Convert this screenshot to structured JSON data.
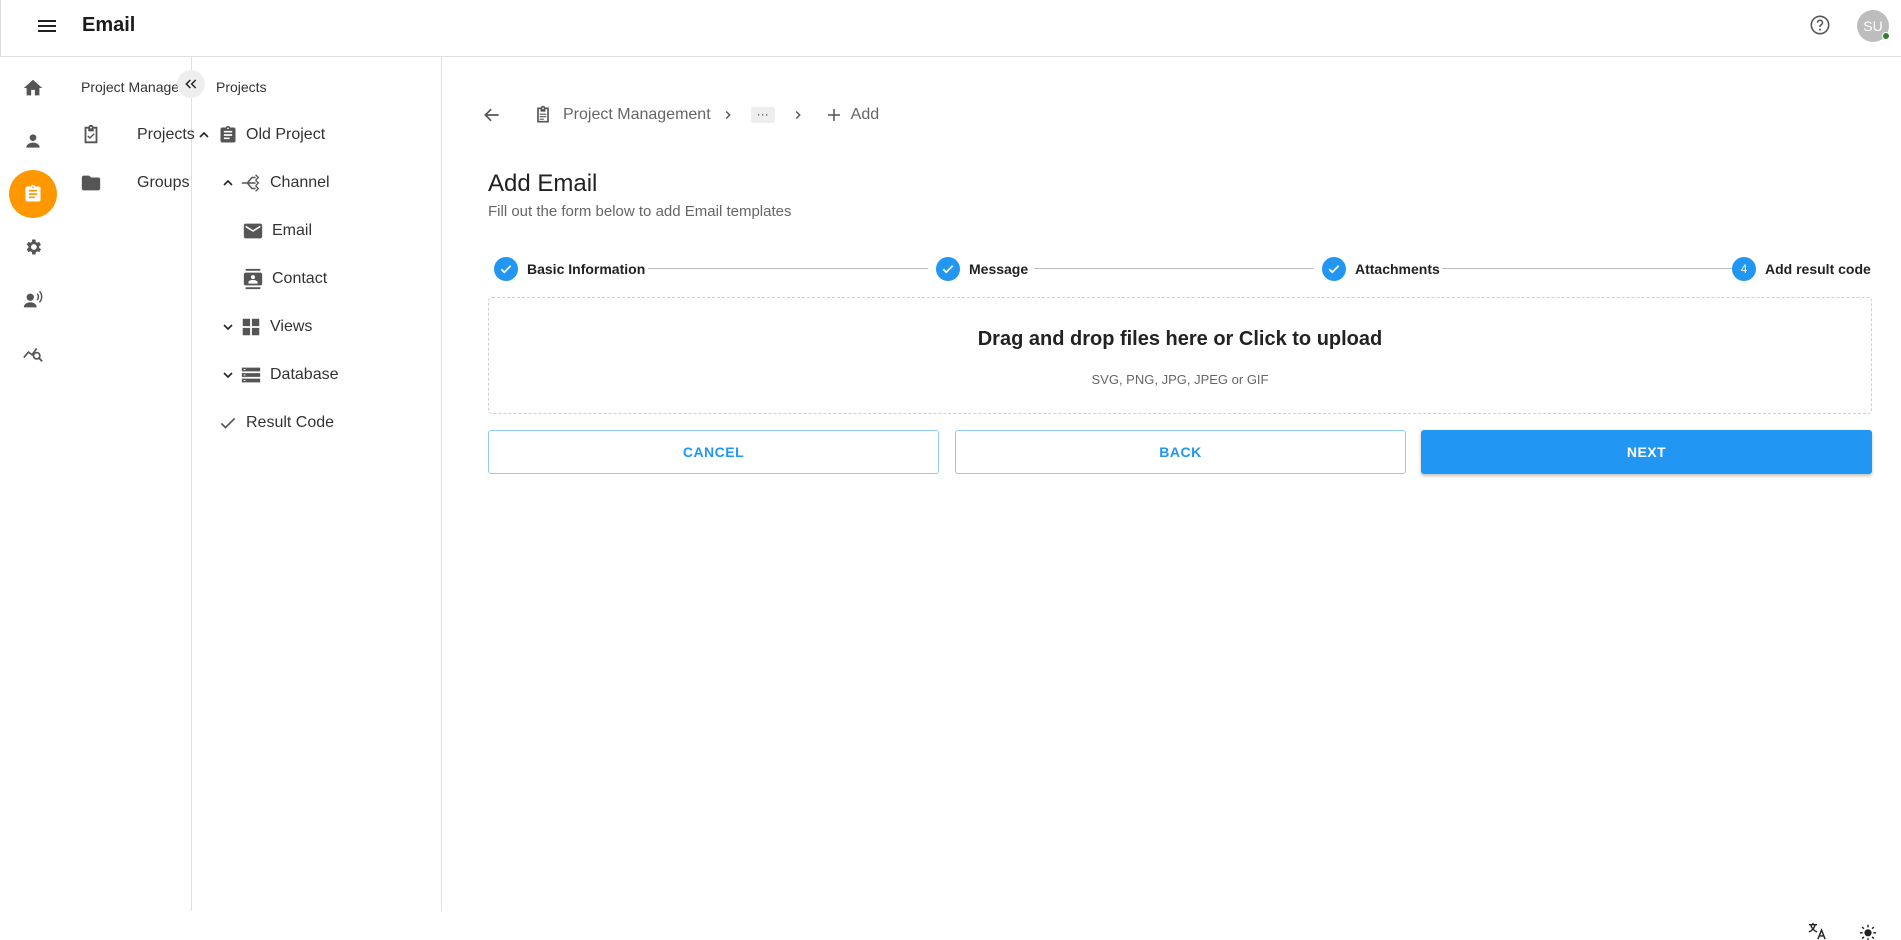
{
  "header": {
    "title": "Email",
    "avatar_initials": "SU"
  },
  "rail": {
    "items": [
      {
        "icon": "home-icon"
      },
      {
        "icon": "person-icon"
      },
      {
        "icon": "clipboard-icon",
        "active": true
      },
      {
        "icon": "settings-icon"
      },
      {
        "icon": "record-voice-icon"
      },
      {
        "icon": "analytics-search-icon"
      }
    ]
  },
  "panel1": {
    "title": "Project Management",
    "items": [
      {
        "label": "Projects",
        "icon": "checklist-icon"
      },
      {
        "label": "Groups",
        "icon": "folder-icon"
      }
    ]
  },
  "panel2": {
    "title": "Projects",
    "tree": [
      {
        "label": "Old Project",
        "icon": "clipboard-icon",
        "chevron": "up"
      },
      {
        "label": "Channel",
        "icon": "channel-icon",
        "chevron": "up"
      },
      {
        "label": "Email",
        "icon": "mail-icon"
      },
      {
        "label": "Contact",
        "icon": "contact-icon"
      },
      {
        "label": "Views",
        "icon": "grid-icon",
        "chevron": "down"
      },
      {
        "label": "Database",
        "icon": "list-icon",
        "chevron": "down"
      },
      {
        "label": "Result Code",
        "icon": "check-icon"
      }
    ]
  },
  "breadcrumb": {
    "root": "Project Management",
    "ellipsis": "···",
    "current": "Add"
  },
  "page": {
    "title": "Add Email",
    "subtitle": "Fill out the form below to add Email templates"
  },
  "stepper": {
    "steps": [
      {
        "label": "Basic Information",
        "state": "done"
      },
      {
        "label": "Message",
        "state": "done"
      },
      {
        "label": "Attachments",
        "state": "done"
      },
      {
        "label": "Add result code",
        "state": "active",
        "number": "4"
      }
    ]
  },
  "dropzone": {
    "title": "Drag and drop files here or Click to upload",
    "formats": "SVG, PNG, JPG, JPEG or GIF"
  },
  "actions": {
    "cancel": "CANCEL",
    "back": "BACK",
    "next": "NEXT"
  },
  "colors": {
    "accent": "#2196f3",
    "active_rail": "#ff9800",
    "online": "#2e7d32"
  }
}
